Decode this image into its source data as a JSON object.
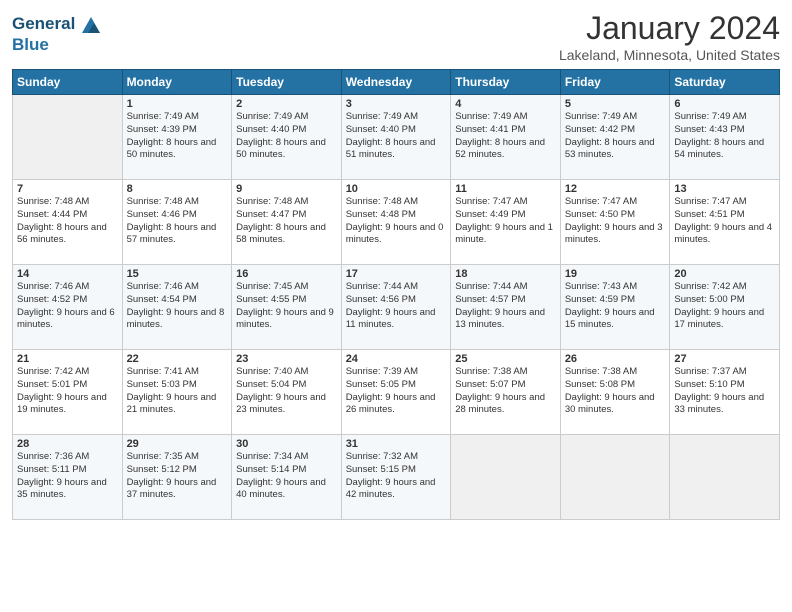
{
  "header": {
    "logo_line1": "General",
    "logo_line2": "Blue",
    "month": "January 2024",
    "location": "Lakeland, Minnesota, United States"
  },
  "weekdays": [
    "Sunday",
    "Monday",
    "Tuesday",
    "Wednesday",
    "Thursday",
    "Friday",
    "Saturday"
  ],
  "weeks": [
    [
      {
        "day": "",
        "sunrise": "",
        "sunset": "",
        "daylight": ""
      },
      {
        "day": "1",
        "sunrise": "Sunrise: 7:49 AM",
        "sunset": "Sunset: 4:39 PM",
        "daylight": "Daylight: 8 hours and 50 minutes."
      },
      {
        "day": "2",
        "sunrise": "Sunrise: 7:49 AM",
        "sunset": "Sunset: 4:40 PM",
        "daylight": "Daylight: 8 hours and 50 minutes."
      },
      {
        "day": "3",
        "sunrise": "Sunrise: 7:49 AM",
        "sunset": "Sunset: 4:40 PM",
        "daylight": "Daylight: 8 hours and 51 minutes."
      },
      {
        "day": "4",
        "sunrise": "Sunrise: 7:49 AM",
        "sunset": "Sunset: 4:41 PM",
        "daylight": "Daylight: 8 hours and 52 minutes."
      },
      {
        "day": "5",
        "sunrise": "Sunrise: 7:49 AM",
        "sunset": "Sunset: 4:42 PM",
        "daylight": "Daylight: 8 hours and 53 minutes."
      },
      {
        "day": "6",
        "sunrise": "Sunrise: 7:49 AM",
        "sunset": "Sunset: 4:43 PM",
        "daylight": "Daylight: 8 hours and 54 minutes."
      }
    ],
    [
      {
        "day": "7",
        "sunrise": "Sunrise: 7:48 AM",
        "sunset": "Sunset: 4:44 PM",
        "daylight": "Daylight: 8 hours and 56 minutes."
      },
      {
        "day": "8",
        "sunrise": "Sunrise: 7:48 AM",
        "sunset": "Sunset: 4:46 PM",
        "daylight": "Daylight: 8 hours and 57 minutes."
      },
      {
        "day": "9",
        "sunrise": "Sunrise: 7:48 AM",
        "sunset": "Sunset: 4:47 PM",
        "daylight": "Daylight: 8 hours and 58 minutes."
      },
      {
        "day": "10",
        "sunrise": "Sunrise: 7:48 AM",
        "sunset": "Sunset: 4:48 PM",
        "daylight": "Daylight: 9 hours and 0 minutes."
      },
      {
        "day": "11",
        "sunrise": "Sunrise: 7:47 AM",
        "sunset": "Sunset: 4:49 PM",
        "daylight": "Daylight: 9 hours and 1 minute."
      },
      {
        "day": "12",
        "sunrise": "Sunrise: 7:47 AM",
        "sunset": "Sunset: 4:50 PM",
        "daylight": "Daylight: 9 hours and 3 minutes."
      },
      {
        "day": "13",
        "sunrise": "Sunrise: 7:47 AM",
        "sunset": "Sunset: 4:51 PM",
        "daylight": "Daylight: 9 hours and 4 minutes."
      }
    ],
    [
      {
        "day": "14",
        "sunrise": "Sunrise: 7:46 AM",
        "sunset": "Sunset: 4:52 PM",
        "daylight": "Daylight: 9 hours and 6 minutes."
      },
      {
        "day": "15",
        "sunrise": "Sunrise: 7:46 AM",
        "sunset": "Sunset: 4:54 PM",
        "daylight": "Daylight: 9 hours and 8 minutes."
      },
      {
        "day": "16",
        "sunrise": "Sunrise: 7:45 AM",
        "sunset": "Sunset: 4:55 PM",
        "daylight": "Daylight: 9 hours and 9 minutes."
      },
      {
        "day": "17",
        "sunrise": "Sunrise: 7:44 AM",
        "sunset": "Sunset: 4:56 PM",
        "daylight": "Daylight: 9 hours and 11 minutes."
      },
      {
        "day": "18",
        "sunrise": "Sunrise: 7:44 AM",
        "sunset": "Sunset: 4:57 PM",
        "daylight": "Daylight: 9 hours and 13 minutes."
      },
      {
        "day": "19",
        "sunrise": "Sunrise: 7:43 AM",
        "sunset": "Sunset: 4:59 PM",
        "daylight": "Daylight: 9 hours and 15 minutes."
      },
      {
        "day": "20",
        "sunrise": "Sunrise: 7:42 AM",
        "sunset": "Sunset: 5:00 PM",
        "daylight": "Daylight: 9 hours and 17 minutes."
      }
    ],
    [
      {
        "day": "21",
        "sunrise": "Sunrise: 7:42 AM",
        "sunset": "Sunset: 5:01 PM",
        "daylight": "Daylight: 9 hours and 19 minutes."
      },
      {
        "day": "22",
        "sunrise": "Sunrise: 7:41 AM",
        "sunset": "Sunset: 5:03 PM",
        "daylight": "Daylight: 9 hours and 21 minutes."
      },
      {
        "day": "23",
        "sunrise": "Sunrise: 7:40 AM",
        "sunset": "Sunset: 5:04 PM",
        "daylight": "Daylight: 9 hours and 23 minutes."
      },
      {
        "day": "24",
        "sunrise": "Sunrise: 7:39 AM",
        "sunset": "Sunset: 5:05 PM",
        "daylight": "Daylight: 9 hours and 26 minutes."
      },
      {
        "day": "25",
        "sunrise": "Sunrise: 7:38 AM",
        "sunset": "Sunset: 5:07 PM",
        "daylight": "Daylight: 9 hours and 28 minutes."
      },
      {
        "day": "26",
        "sunrise": "Sunrise: 7:38 AM",
        "sunset": "Sunset: 5:08 PM",
        "daylight": "Daylight: 9 hours and 30 minutes."
      },
      {
        "day": "27",
        "sunrise": "Sunrise: 7:37 AM",
        "sunset": "Sunset: 5:10 PM",
        "daylight": "Daylight: 9 hours and 33 minutes."
      }
    ],
    [
      {
        "day": "28",
        "sunrise": "Sunrise: 7:36 AM",
        "sunset": "Sunset: 5:11 PM",
        "daylight": "Daylight: 9 hours and 35 minutes."
      },
      {
        "day": "29",
        "sunrise": "Sunrise: 7:35 AM",
        "sunset": "Sunset: 5:12 PM",
        "daylight": "Daylight: 9 hours and 37 minutes."
      },
      {
        "day": "30",
        "sunrise": "Sunrise: 7:34 AM",
        "sunset": "Sunset: 5:14 PM",
        "daylight": "Daylight: 9 hours and 40 minutes."
      },
      {
        "day": "31",
        "sunrise": "Sunrise: 7:32 AM",
        "sunset": "Sunset: 5:15 PM",
        "daylight": "Daylight: 9 hours and 42 minutes."
      },
      {
        "day": "",
        "sunrise": "",
        "sunset": "",
        "daylight": ""
      },
      {
        "day": "",
        "sunrise": "",
        "sunset": "",
        "daylight": ""
      },
      {
        "day": "",
        "sunrise": "",
        "sunset": "",
        "daylight": ""
      }
    ]
  ]
}
